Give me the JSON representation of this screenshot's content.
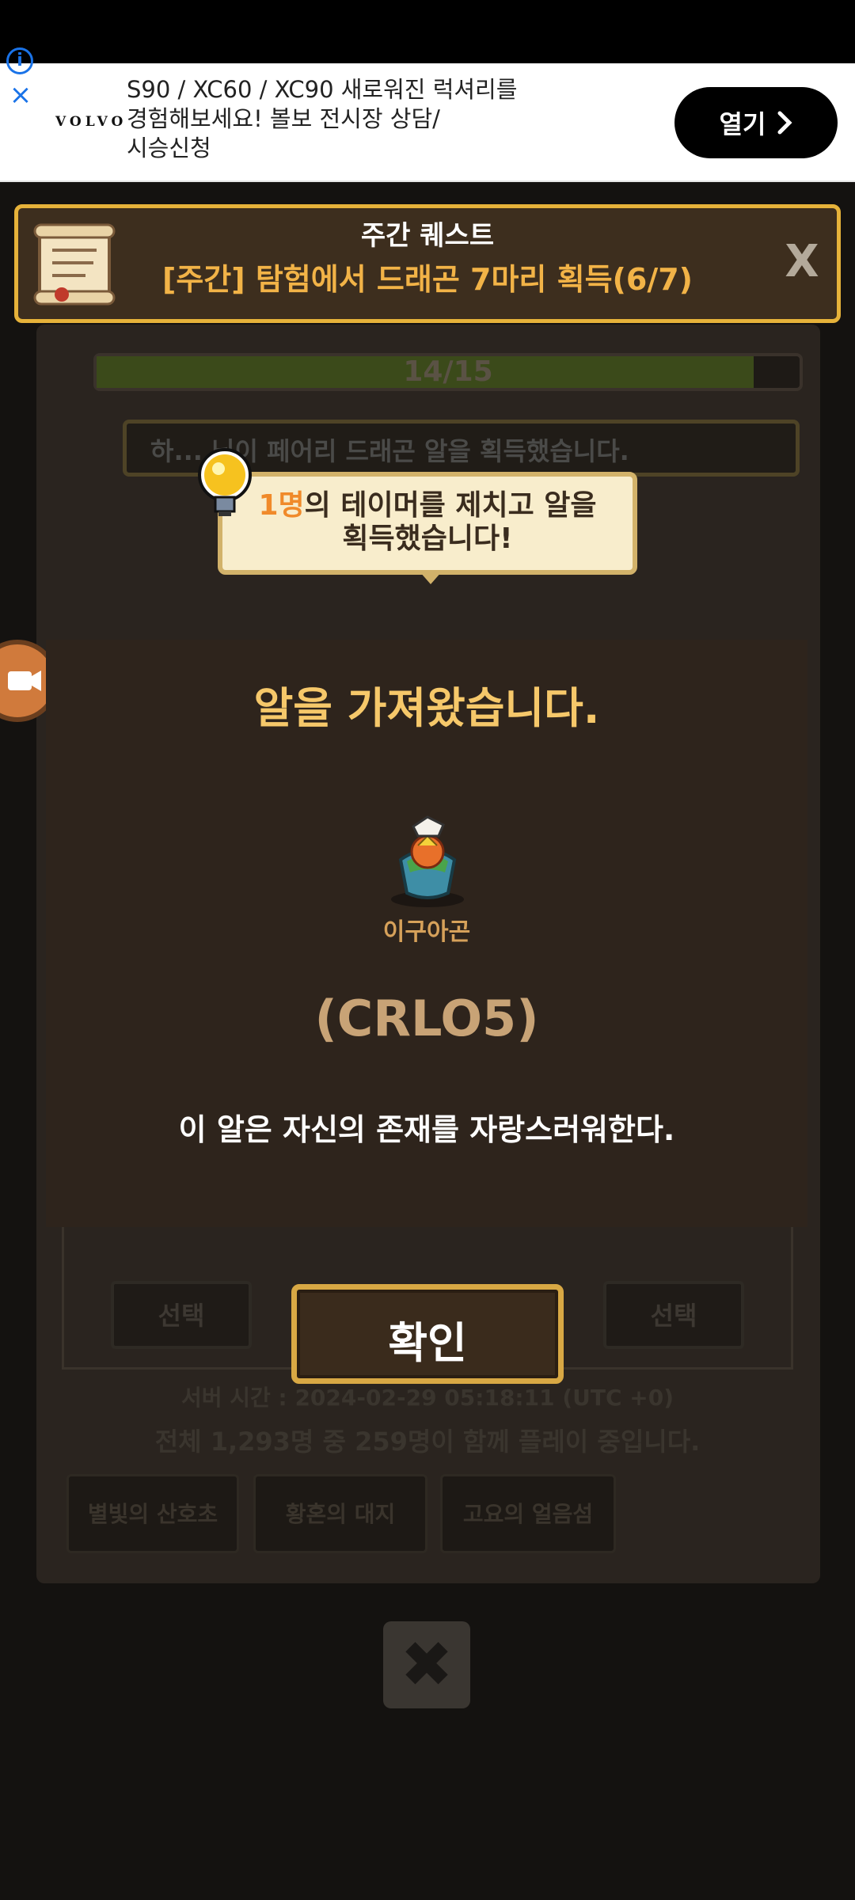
{
  "ad": {
    "text": "S90 / XC60 / XC90 새로워진 럭셔리를\n경험해보세요! 볼보 전시장 상담/\n시승신청",
    "logo": "VOLVO",
    "open_label": "열기",
    "open_icon": "chevron-right-icon"
  },
  "quest": {
    "title": "주간 퀘스트",
    "desc": "[주간] 탐험에서 드래곤 7마리 획득(6/7)",
    "close_label": "X"
  },
  "background": {
    "progress": "14/15",
    "notice": "하... 님이 페어리 드래곤 알을 획득했습니다.",
    "select_label": "선택",
    "server_time": "서버 시간 : 2024-02-29 05:18:11 (UTC +0)",
    "players": "전체 1,293명 중 259명이 함께 플레이 중입니다.",
    "tabs": [
      "별빛의 산호초",
      "황혼의 대지",
      "고요의 얼음섬"
    ]
  },
  "tooltip": {
    "count": "1명",
    "line1_rest": "의 테이머를 제치고 알을",
    "line2": "획득했습니다!"
  },
  "dialog": {
    "title": "알을 가져왔습니다.",
    "dragon_name": "이구아곤",
    "dragon_code": "(CRLO5)",
    "description": "이 알은 자신의 존재를 자랑스러워한다.",
    "confirm_label": "확인"
  },
  "colors": {
    "accent_gold": "#e6b23a",
    "dialog_title": "#f6c86a",
    "quest_desc": "#f2b347",
    "highlight": "#f08a2a"
  }
}
